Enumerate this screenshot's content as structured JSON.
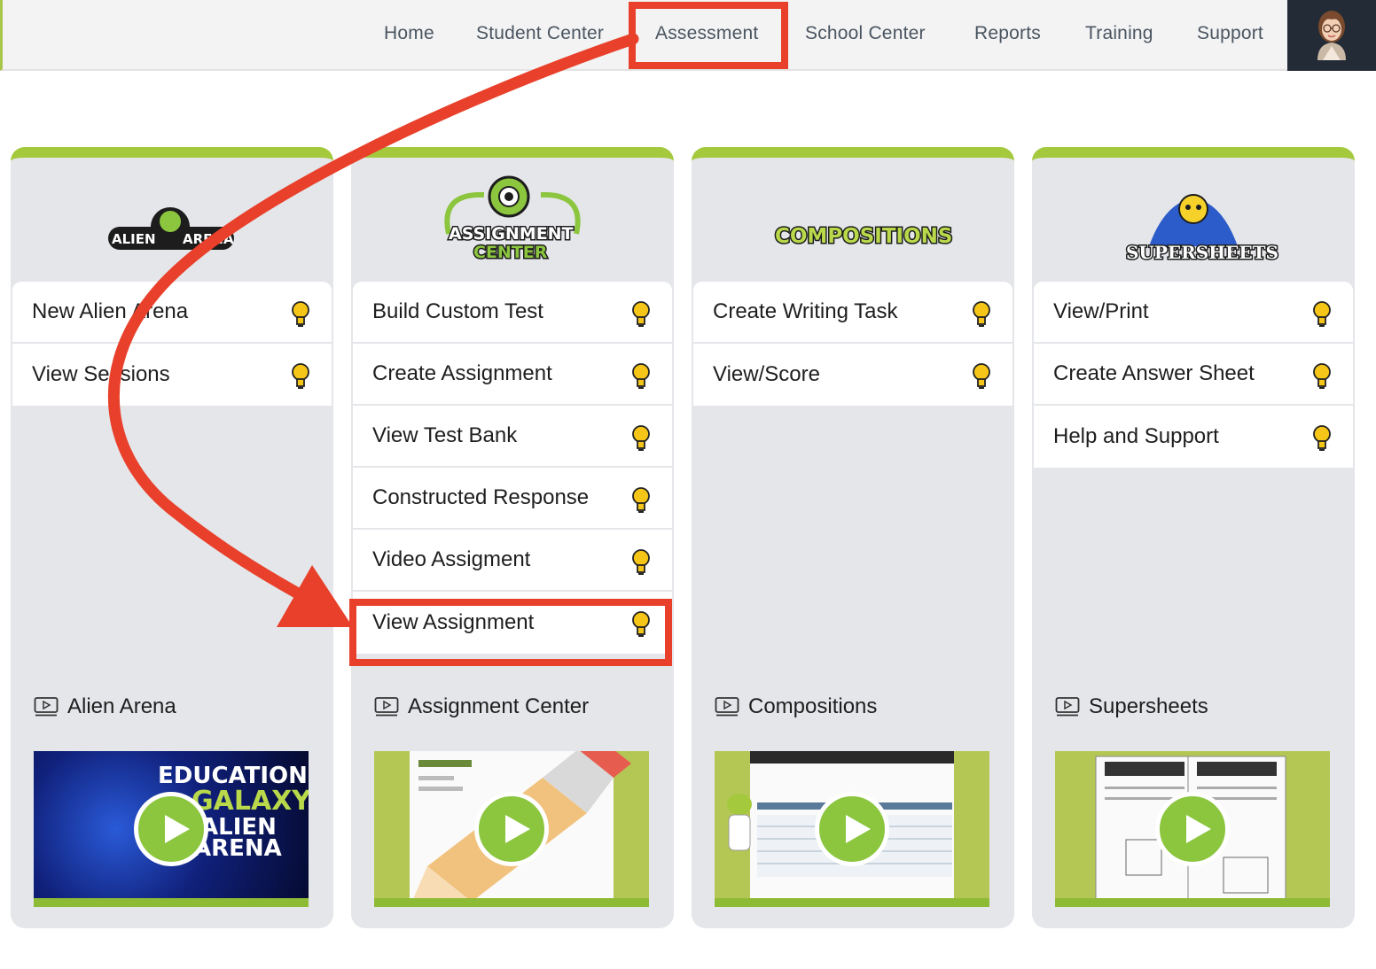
{
  "nav": {
    "items": [
      {
        "label": "Home"
      },
      {
        "label": "Student Center"
      },
      {
        "label": "Assessment"
      },
      {
        "label": "School Center"
      },
      {
        "label": "Reports"
      },
      {
        "label": "Training"
      },
      {
        "label": "Support"
      }
    ],
    "active": "Assessment"
  },
  "cards": [
    {
      "logo_text": "ALIEN ARENA",
      "items": [
        {
          "label": "New Alien Arena"
        },
        {
          "label": "View Sessions"
        }
      ],
      "video_label": "Alien Arena",
      "thumb_text": [
        "EDUCATION",
        "GALAXY",
        "ALIEN",
        "ARENA"
      ]
    },
    {
      "logo_text": [
        "ASSIGNMENT",
        "CENTER"
      ],
      "items": [
        {
          "label": "Build Custom Test"
        },
        {
          "label": "Create Assignment"
        },
        {
          "label": "View Test Bank"
        },
        {
          "label": "Constructed Response"
        },
        {
          "label": "Video Assigment"
        },
        {
          "label": "View Assignment"
        }
      ],
      "video_label": "Assignment Center"
    },
    {
      "logo_text": "COMPOSITIONS",
      "items": [
        {
          "label": "Create Writing Task"
        },
        {
          "label": "View/Score"
        }
      ],
      "video_label": "Compositions"
    },
    {
      "logo_text": "SUPERSHEETS",
      "items": [
        {
          "label": "View/Print"
        },
        {
          "label": "Create Answer Sheet"
        },
        {
          "label": "Help and Support"
        }
      ],
      "video_label": "Supersheets"
    }
  ],
  "annotations": {
    "color": "#e8402a",
    "highlighted": [
      "Assessment",
      "View Assignment"
    ]
  },
  "colors": {
    "accent": "#a4c93d",
    "bulb": "#f5c518",
    "play": "#8cc63f"
  }
}
